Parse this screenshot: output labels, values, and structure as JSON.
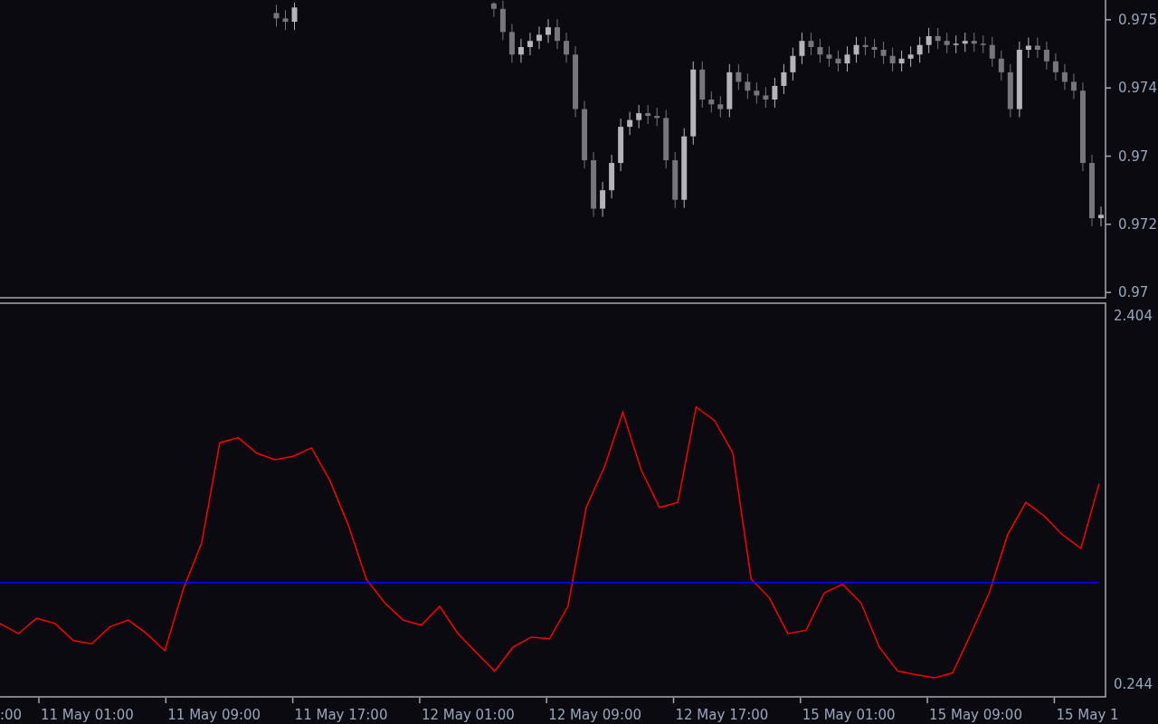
{
  "price_panel": {
    "chart_data": {
      "type": "candlestick",
      "ylim": [
        0.97091,
        0.97529
      ],
      "yticks": [
        {
          "value": 0.975,
          "label": "0.975"
        },
        {
          "value": 0.974,
          "label": "0.974"
        },
        {
          "value": 0.973,
          "label": "0.97"
        },
        {
          "value": 0.972,
          "label": "0.972"
        },
        {
          "value": 0.971,
          "label": "0.97"
        }
      ],
      "categories": [
        null,
        null,
        null,
        null,
        null,
        null,
        null,
        null,
        null,
        null,
        null,
        null,
        null,
        null,
        null,
        null,
        null,
        null,
        null,
        null,
        null,
        null,
        null,
        null,
        null,
        null,
        null,
        null,
        null,
        null,
        null,
        null,
        null,
        null,
        null,
        null,
        null,
        null,
        null,
        null,
        null,
        null,
        null,
        null,
        null,
        null,
        null,
        null,
        null,
        null,
        null,
        null,
        null,
        null,
        null,
        null,
        null,
        null,
        null,
        null,
        null,
        null,
        null,
        null,
        null,
        null,
        null,
        null,
        null,
        null,
        null,
        null,
        null,
        null,
        null,
        null,
        null,
        null,
        null,
        null,
        null,
        null,
        null,
        null,
        null,
        null,
        null,
        null,
        null,
        null,
        null,
        null,
        null,
        null,
        null,
        null,
        null,
        null,
        null,
        null,
        null,
        null,
        null,
        null,
        null,
        null,
        null,
        null,
        null,
        null,
        null,
        null,
        null,
        null,
        null,
        null,
        null,
        null,
        null,
        null,
        null,
        null
      ],
      "ohlc": [
        null,
        null,
        null,
        null,
        null,
        null,
        null,
        null,
        null,
        null,
        null,
        null,
        null,
        null,
        null,
        null,
        null,
        null,
        null,
        null,
        null,
        null,
        null,
        null,
        null,
        null,
        null,
        null,
        null,
        null,
        [
          0.9751,
          0.97522,
          0.9749,
          0.97502
        ],
        [
          0.97502,
          0.97514,
          0.97485,
          0.97497
        ],
        [
          0.97497,
          0.97525,
          0.97485,
          0.97518
        ],
        null,
        null,
        null,
        null,
        null,
        null,
        null,
        null,
        null,
        null,
        null,
        null,
        null,
        null,
        null,
        null,
        null,
        null,
        null,
        null,
        null,
        [
          0.97524,
          0.97526,
          0.97504,
          0.97516
        ],
        [
          0.97516,
          0.97528,
          0.9747,
          0.97482
        ],
        [
          0.97482,
          0.97494,
          0.97437,
          0.97449
        ],
        [
          0.97449,
          0.97472,
          0.97437,
          0.9746
        ],
        [
          0.9746,
          0.97481,
          0.97448,
          0.97469
        ],
        [
          0.97469,
          0.9749,
          0.97457,
          0.97478
        ],
        [
          0.97478,
          0.97501,
          0.97466,
          0.97489
        ],
        [
          0.97489,
          0.97501,
          0.97457,
          0.97469
        ],
        [
          0.97469,
          0.97481,
          0.97437,
          0.97449
        ],
        [
          0.97449,
          0.97461,
          0.97357,
          0.97369
        ],
        [
          0.97369,
          0.97381,
          0.97282,
          0.97294
        ],
        [
          0.97294,
          0.97306,
          0.97211,
          0.97223
        ],
        [
          0.97223,
          0.97262,
          0.97211,
          0.9725
        ],
        [
          0.9725,
          0.97302,
          0.97238,
          0.9729
        ],
        [
          0.9729,
          0.97355,
          0.97278,
          0.97343
        ],
        [
          0.97343,
          0.97365,
          0.97331,
          0.97353
        ],
        [
          0.97353,
          0.97375,
          0.97341,
          0.97363
        ],
        [
          0.97363,
          0.97375,
          0.97347,
          0.97359
        ],
        [
          0.97359,
          0.97371,
          0.97344,
          0.97356
        ],
        [
          0.97356,
          0.97368,
          0.97282,
          0.97294
        ],
        [
          0.97294,
          0.97306,
          0.97224,
          0.97236
        ],
        [
          0.97236,
          0.97341,
          0.97224,
          0.97329
        ],
        [
          0.97329,
          0.97439,
          0.97317,
          0.97427
        ],
        [
          0.97427,
          0.97439,
          0.97371,
          0.97383
        ],
        [
          0.97383,
          0.97395,
          0.97364,
          0.97376
        ],
        [
          0.97376,
          0.97388,
          0.97357,
          0.97369
        ],
        [
          0.97369,
          0.97435,
          0.97357,
          0.97423
        ],
        [
          0.97423,
          0.97435,
          0.97397,
          0.97409
        ],
        [
          0.97409,
          0.97421,
          0.97384,
          0.97396
        ],
        [
          0.97396,
          0.97408,
          0.97377,
          0.97389
        ],
        [
          0.97389,
          0.97401,
          0.97371,
          0.97383
        ],
        [
          0.97383,
          0.97415,
          0.97371,
          0.97403
        ],
        [
          0.97403,
          0.97435,
          0.97391,
          0.97423
        ],
        [
          0.97423,
          0.97459,
          0.97411,
          0.97447
        ],
        [
          0.97447,
          0.97481,
          0.97435,
          0.97469
        ],
        [
          0.97469,
          0.97481,
          0.97448,
          0.9746
        ],
        [
          0.9746,
          0.97472,
          0.97437,
          0.97449
        ],
        [
          0.97449,
          0.97461,
          0.97431,
          0.97443
        ],
        [
          0.97443,
          0.97455,
          0.97424,
          0.97436
        ],
        [
          0.97436,
          0.97461,
          0.97424,
          0.97449
        ],
        [
          0.97449,
          0.97475,
          0.97437,
          0.97463
        ],
        [
          0.97463,
          0.97475,
          0.97448,
          0.9746
        ],
        [
          0.9746,
          0.97472,
          0.97444,
          0.97456
        ],
        [
          0.97456,
          0.97468,
          0.97435,
          0.97447
        ],
        [
          0.97447,
          0.97459,
          0.97424,
          0.97436
        ],
        [
          0.97436,
          0.97455,
          0.97424,
          0.97443
        ],
        [
          0.97443,
          0.97461,
          0.97431,
          0.97449
        ],
        [
          0.97449,
          0.97475,
          0.97437,
          0.97463
        ],
        [
          0.97463,
          0.97488,
          0.97451,
          0.97476
        ],
        [
          0.97476,
          0.97488,
          0.97457,
          0.97469
        ],
        [
          0.97469,
          0.97481,
          0.97451,
          0.97463
        ],
        [
          0.97463,
          0.97477,
          0.97451,
          0.97465
        ],
        [
          0.97465,
          0.97481,
          0.97453,
          0.97469
        ],
        [
          0.97469,
          0.97481,
          0.97453,
          0.97465
        ],
        [
          0.97465,
          0.97477,
          0.97451,
          0.97463
        ],
        [
          0.97463,
          0.97475,
          0.97431,
          0.97443
        ],
        [
          0.97443,
          0.97455,
          0.97411,
          0.97423
        ],
        [
          0.97423,
          0.97435,
          0.97357,
          0.97369
        ],
        [
          0.97369,
          0.97468,
          0.97357,
          0.97456
        ],
        [
          0.97456,
          0.97474,
          0.97444,
          0.97462
        ],
        [
          0.97462,
          0.97474,
          0.97444,
          0.97456
        ],
        [
          0.97456,
          0.97468,
          0.97427,
          0.97439
        ],
        [
          0.97439,
          0.97451,
          0.97411,
          0.97423
        ],
        [
          0.97423,
          0.97435,
          0.97397,
          0.97409
        ],
        [
          0.97409,
          0.97421,
          0.97384,
          0.97396
        ],
        [
          0.97396,
          0.97408,
          0.97278,
          0.9729
        ],
        [
          0.9729,
          0.97302,
          0.97197,
          0.97209
        ],
        [
          0.97209,
          0.97226,
          0.97197,
          0.97214
        ]
      ]
    }
  },
  "indicator_panel": {
    "chart_data": {
      "type": "line",
      "ylim": [
        0.164,
        2.484
      ],
      "yticks": [
        2.404,
        0.244
      ],
      "series": [
        {
          "color": "#ff0000",
          "values": [
            0.6,
            0.54,
            0.63,
            0.6,
            0.5,
            0.48,
            0.58,
            0.62,
            0.54,
            0.44,
            0.8,
            1.07,
            1.66,
            1.69,
            1.6,
            1.56,
            1.58,
            1.63,
            1.44,
            1.18,
            0.86,
            0.72,
            0.62,
            0.59,
            0.7,
            0.54,
            0.43,
            0.32,
            0.46,
            0.52,
            0.51,
            0.7,
            1.28,
            1.52,
            1.84,
            1.5,
            1.28,
            1.31,
            1.87,
            1.79,
            1.6,
            0.86,
            0.75,
            0.54,
            0.56,
            0.78,
            0.83,
            0.72,
            0.46,
            0.32,
            0.3,
            0.28,
            0.31,
            0.54,
            0.78,
            1.12,
            1.31,
            1.23,
            1.12,
            1.04,
            1.42
          ]
        },
        {
          "color": "#0000ff",
          "values": [
            0.84,
            0.84,
            0.84,
            0.84,
            0.84,
            0.84,
            0.84,
            0.84,
            0.84,
            0.84,
            0.84,
            0.84,
            0.84,
            0.84,
            0.84,
            0.84,
            0.84,
            0.84,
            0.84,
            0.84,
            0.84,
            0.84,
            0.84,
            0.84,
            0.84,
            0.84,
            0.84,
            0.84,
            0.84,
            0.84,
            0.84,
            0.84,
            0.84,
            0.84,
            0.84,
            0.84,
            0.84,
            0.84,
            0.84,
            0.84,
            0.84,
            0.84,
            0.84,
            0.84,
            0.84,
            0.84,
            0.84,
            0.84,
            0.84,
            0.84,
            0.84,
            0.84,
            0.84,
            0.84,
            0.84,
            0.84,
            0.84,
            0.84,
            0.84,
            0.84,
            0.84
          ]
        }
      ]
    }
  },
  "time_axis": {
    "labels": [
      ":00",
      "11 May 01:00",
      "11 May 09:00",
      "11 May 17:00",
      "12 May 01:00",
      "12 May 09:00",
      "12 May 17:00",
      "15 May 01:00",
      "15 May 09:00",
      "15 May 1"
    ]
  }
}
